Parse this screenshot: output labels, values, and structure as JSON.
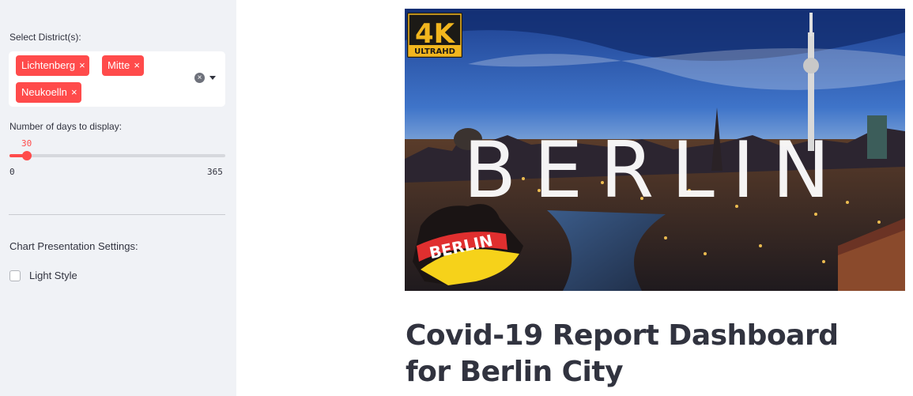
{
  "sidebar": {
    "district_label": "Select District(s):",
    "districts": [
      "Lichtenberg",
      "Mitte",
      "Neukoelln"
    ],
    "remove_glyph": "×",
    "clear_glyph": "×",
    "days_label": "Number of days to display:",
    "days": {
      "value": "30",
      "min": "0",
      "max": "365"
    },
    "chart_settings_label": "Chart Presentation Settings:",
    "light_style_label": "Light Style",
    "light_style_checked": false
  },
  "hero": {
    "badge_big": "4K",
    "badge_small": "ULTRAHD",
    "city_word": "BERLIN",
    "flag_word": "BERLIN"
  },
  "main": {
    "title": "Covid-19 Report Dashboard for Berlin City"
  },
  "colors": {
    "accent": "#ff4b4b",
    "sidebar_bg": "#f0f2f6",
    "text": "#31333f"
  }
}
